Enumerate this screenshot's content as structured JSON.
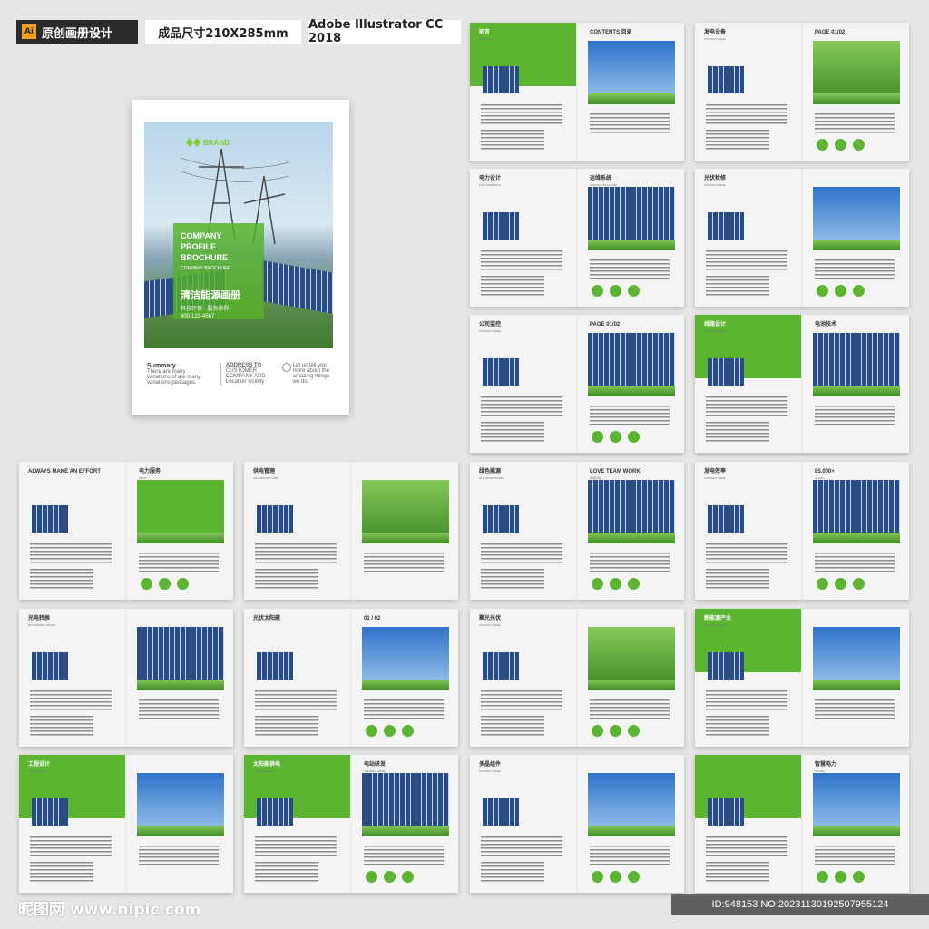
{
  "header": {
    "ai_badge": "Ai",
    "title": "原创画册设计",
    "size": "成品尺寸210X285mm",
    "software": "Adobe Illustrator CC 2018"
  },
  "cover": {
    "brand": "BRAND",
    "heading": "COMPANY\nPROFILE\nBROCHURE",
    "cn_title": "清洁能源画册",
    "tag": "COMPANY BROCHURE",
    "sub": "科技环保 · 服务世界",
    "phone": "400-123-4567",
    "summary_title": "Summary",
    "summary_text": "There are many variations of are many variations passages.",
    "address_title": "ADDRESS TO",
    "address_text": "CUSTOMER COMPANY ADD Location vicinity",
    "tell_text": "Let us tell you more about the amazing things we do."
  },
  "spreads": [
    {
      "left": "前言",
      "left_en": "PREFACE",
      "right": "CONTENTS 目录",
      "right_en": ""
    },
    {
      "left": "发电设备",
      "left_en": "CONTENT HERE",
      "right": "PAGE 01/02",
      "right_en": ""
    },
    {
      "left": "电力设计",
      "left_en": "OUR STRENGTH",
      "right": "运维系统",
      "right_en": "OVERALL SOLUTION"
    },
    {
      "left": "光伏检修",
      "left_en": "CONTENT HERE",
      "right": "",
      "right_en": ""
    },
    {
      "left": "公司监控",
      "left_en": "CONTENT HERE",
      "right": "PAGE 01/02",
      "right_en": ""
    },
    {
      "left": "线路设计",
      "left_en": "CONTENT HERE",
      "right": "电池技术",
      "right_en": ""
    },
    {
      "left": "ALWAYS MAKE AN EFFORT",
      "left_en": "",
      "right": "电力服务",
      "right_en": "98.5%"
    },
    {
      "left": "供电管理",
      "left_en": "SHOWROOM CASE",
      "right": "",
      "right_en": ""
    },
    {
      "left": "绿色能源",
      "left_en": "OUR ADVANTAGES",
      "right": "LOVE TEAM WORK",
      "right_en": "环保科技"
    },
    {
      "left": "发电效率",
      "left_en": "CONTENT HERE",
      "right": "85.000+",
      "right_en": "30.000+"
    },
    {
      "left": "光电转换",
      "left_en": "ENTERPRISE BRAND",
      "right": "",
      "right_en": ""
    },
    {
      "left": "光伏太阳能",
      "left_en": "",
      "right": "01 / 02",
      "right_en": ""
    },
    {
      "left": "聚光光伏",
      "left_en": "CONTENT HERE",
      "right": "",
      "right_en": ""
    },
    {
      "left": "新能源产业",
      "left_en": "TEAM WORKER",
      "right": "",
      "right_en": ""
    },
    {
      "left": "工程设计",
      "left_en": "TEAM WORKER",
      "right": "",
      "right_en": ""
    },
    {
      "left": "太阳能供电",
      "left_en": "CONTENT HERE",
      "right": "电站研发",
      "right_en": "CONTENT HERE"
    },
    {
      "left": "多晶组件",
      "left_en": "CONTENT HERE",
      "right": "",
      "right_en": ""
    },
    {
      "left": "",
      "left_en": "",
      "right": "智慧电力",
      "right_en": "125.000"
    }
  ],
  "footer": {
    "watermark": "昵图网 www.nipic.com",
    "id_text": "ID:948153 NO:20231130192507955124"
  },
  "colors": {
    "accent": "#5bb531",
    "dark": "#2b2b2b"
  }
}
